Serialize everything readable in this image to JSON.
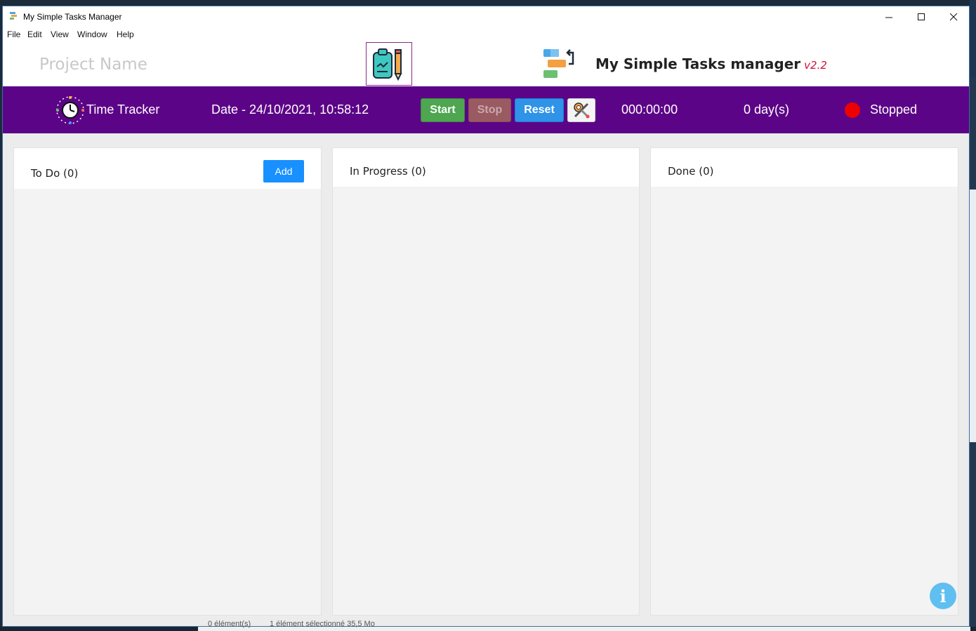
{
  "window": {
    "title": "My Simple Tasks Manager",
    "controls": {
      "minimize": "—",
      "maximize": "☐",
      "close": "✕"
    }
  },
  "menu": {
    "items": [
      "File",
      "Edit",
      "View",
      "Window",
      "Help"
    ]
  },
  "header": {
    "project_name_placeholder": "Project Name",
    "brand_title": "My Simple Tasks manager",
    "brand_version": "v2.2"
  },
  "tracker": {
    "label": "Time Tracker",
    "date": "Date - 24/10/2021, 10:58:12",
    "start_label": "Start",
    "stop_label": "Stop",
    "reset_label": "Reset",
    "timer": "000:00:00",
    "days": "0 day(s)",
    "status": "Stopped",
    "status_color": "#ee0000",
    "accent_color": "#5c0487"
  },
  "board": {
    "columns": [
      {
        "title": "To Do (0)",
        "add_label": "Add"
      },
      {
        "title": "In Progress (0)"
      },
      {
        "title": "Done (0)"
      }
    ]
  },
  "info": {
    "icon": "i"
  },
  "taskbar": {
    "left_text": "0 élément(s)",
    "right_text": "1 élément sélectionné 35,5 Mo"
  }
}
